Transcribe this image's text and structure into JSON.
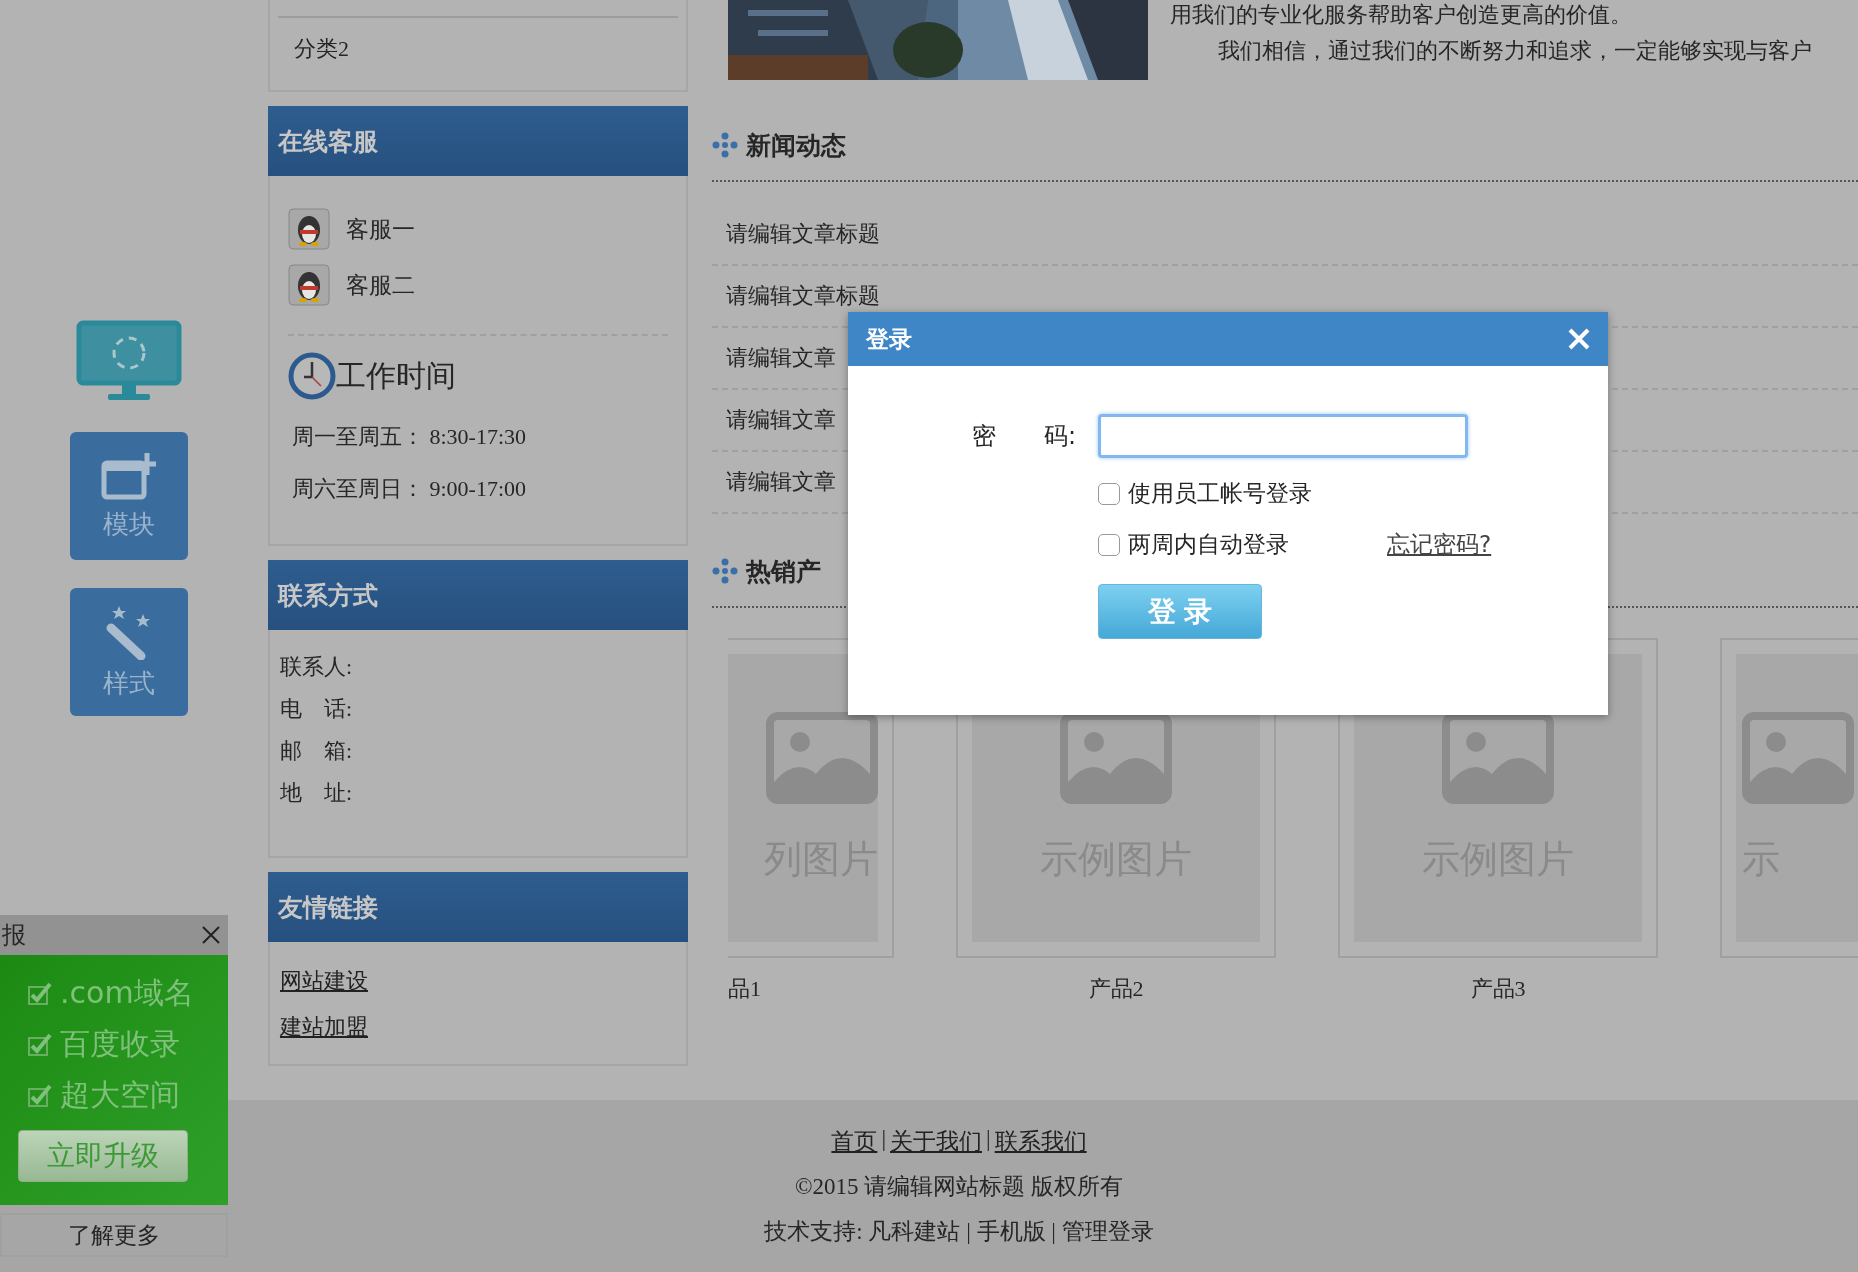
{
  "float_toolbar": {
    "items": [
      {
        "kind": "monitor"
      },
      {
        "kind": "module",
        "label": "模块"
      },
      {
        "kind": "style",
        "label": "样式"
      }
    ]
  },
  "sidebar": {
    "category_box": {
      "items": [
        "分类2"
      ]
    },
    "service": {
      "title": "在线客服",
      "agents": [
        "客服一",
        "客服二"
      ],
      "hours_title": "工作时间",
      "hours": [
        "周一至周五： 8:30-17:30",
        "周六至周日： 9:00-17:00"
      ]
    },
    "contact": {
      "title": "联系方式",
      "fields": [
        "联系人:",
        "电　话:",
        "邮　箱:",
        "地　址:"
      ]
    },
    "links": {
      "title": "友情链接",
      "items": [
        "网站建设",
        "建站加盟"
      ]
    }
  },
  "about": {
    "paragraphs": [
      "用我们的专业化服务帮助客户创造更高的价值。",
      "我们相信，通过我们的不断努力和追求，一定能够实现与客户"
    ]
  },
  "news": {
    "title": "新闻动态",
    "items": [
      "请编辑文章标题",
      "请编辑文章标题",
      "请编辑文章",
      "请编辑文章",
      "请编辑文章"
    ]
  },
  "products": {
    "title": "热销产",
    "items": [
      {
        "placeholder": "列图片",
        "name": "品1"
      },
      {
        "placeholder": "示例图片",
        "name": "产品2"
      },
      {
        "placeholder": "示例图片",
        "name": "产品3"
      },
      {
        "placeholder": "示"
      }
    ]
  },
  "report_widget": {
    "title": "报",
    "features": [
      ".com域名",
      "百度收录",
      "超大空间"
    ],
    "upgrade_button": "立即升级",
    "more": "了解更多"
  },
  "footer": {
    "links": [
      "首页",
      "关于我们",
      "联系我们"
    ],
    "link_separator": "|",
    "copyright": "©2015 请编辑网站标题 版权所有",
    "support": "技术支持: 凡科建站 | 手机版 | 管理登录"
  },
  "login_dialog": {
    "title": "登录",
    "password_label": "密　　码:",
    "options": [
      {
        "label": "使用员工帐号登录",
        "checked": false
      },
      {
        "label": "两周内自动登录",
        "checked": false
      }
    ],
    "forgot_link": "忘记密码?",
    "submit": "登 录"
  }
}
